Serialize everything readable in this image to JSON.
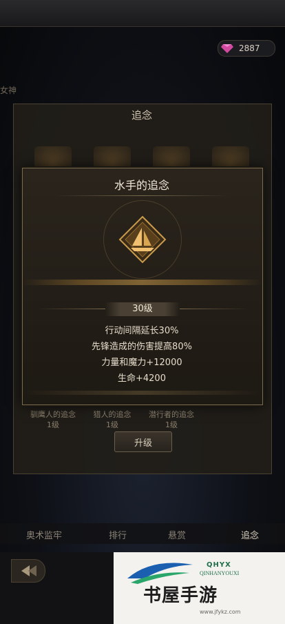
{
  "currency": {
    "value": "2887",
    "icon": "gem-icon"
  },
  "background": {
    "side_text": "女神",
    "tabs": [
      "奥术监牢",
      "排行",
      "悬赏",
      "追念"
    ],
    "active_tab": 3
  },
  "panel": {
    "title": "追念",
    "items": [
      {
        "name": "驯鹰人的追念",
        "level": "1级"
      },
      {
        "name": "猎人的追念",
        "level": "1级"
      },
      {
        "name": "潜行者的追念",
        "level": "1级"
      }
    ],
    "upgrade_label": "升级"
  },
  "modal": {
    "title": "水手的追念",
    "level": "30级",
    "stats": [
      "行动间隔延长30%",
      "先锋造成的伤害提高80%",
      "力量和魔力+12000",
      "生命+4200"
    ]
  },
  "watermark": {
    "brand": "QHYX",
    "sub": "QINHANYOUXI",
    "big": "书屋手游",
    "url": "www.jfykz.com"
  },
  "colors": {
    "accent_gold": "#c99b4c",
    "panel_border": "#7c6b4f"
  }
}
